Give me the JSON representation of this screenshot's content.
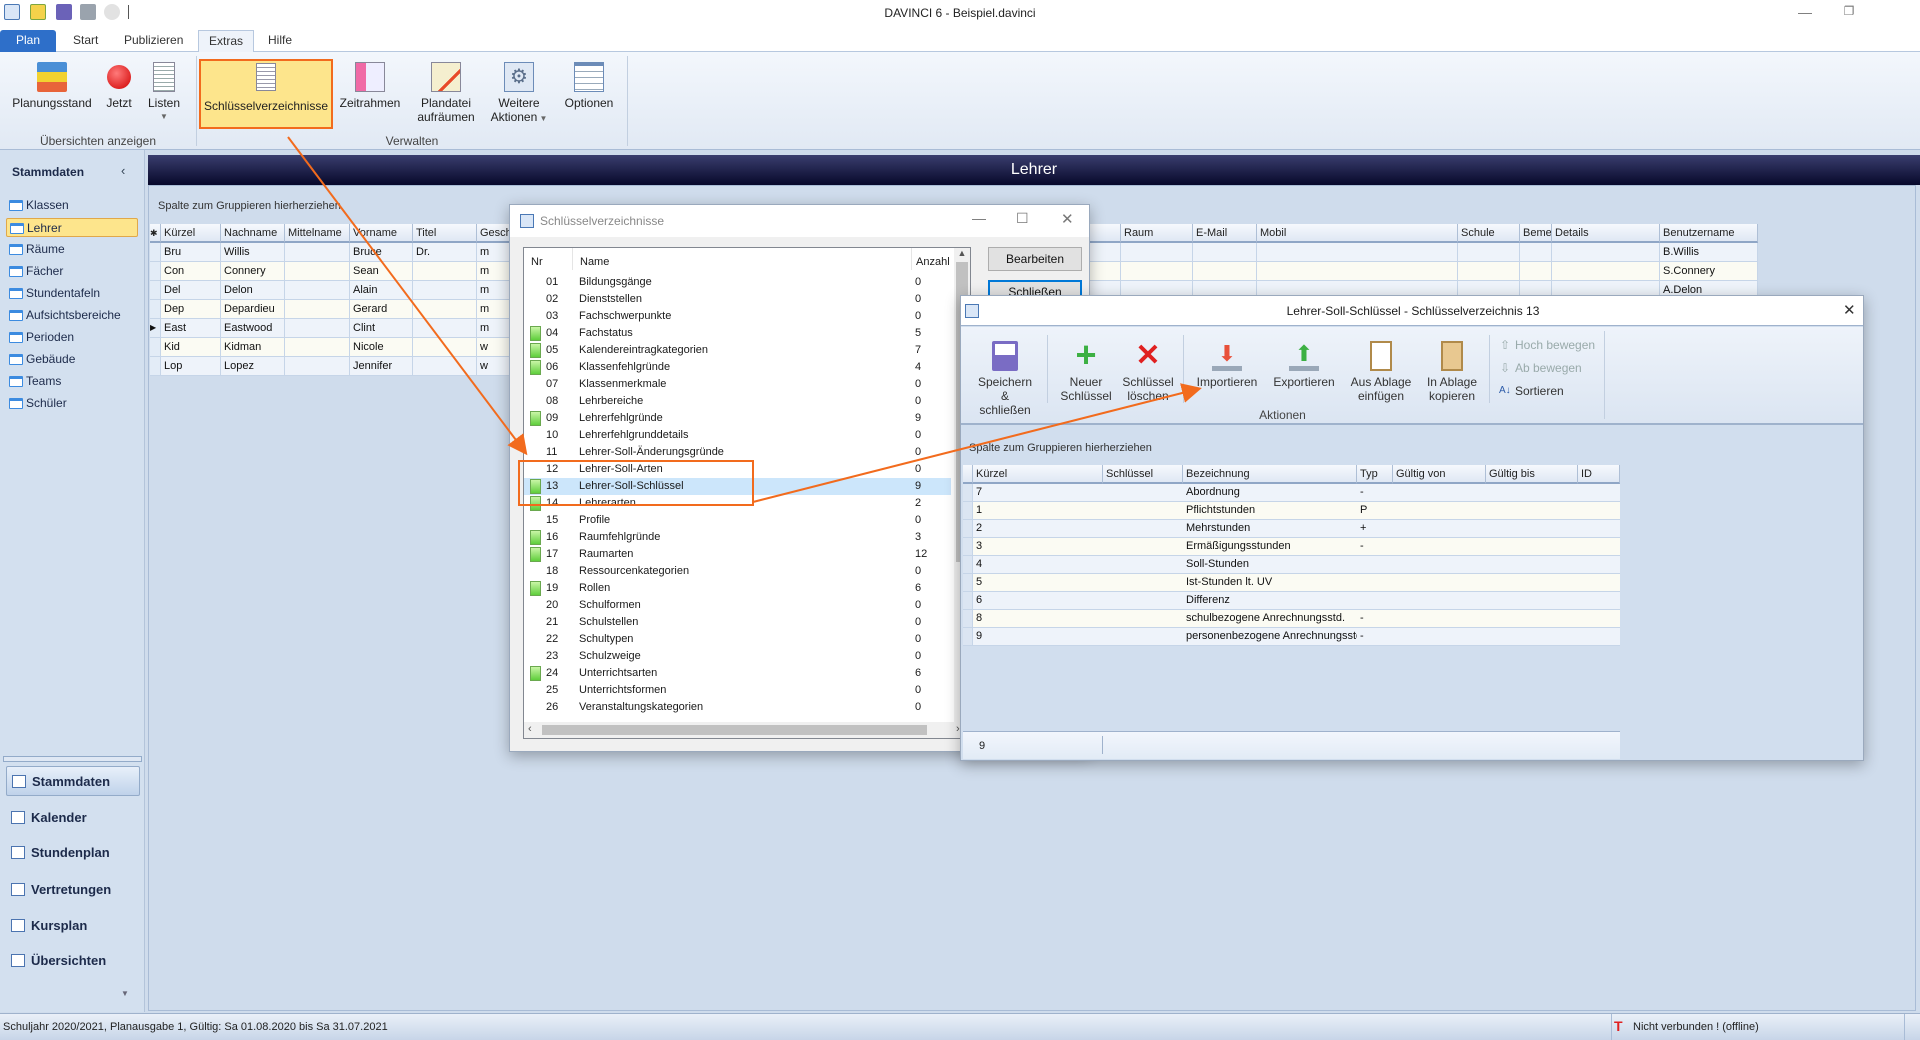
{
  "window": {
    "title": "DAVINCI 6 - Beispiel.davinci",
    "quick_access": [
      "app-icon",
      "open-icon",
      "save-icon",
      "print-icon",
      "refresh-icon"
    ]
  },
  "tabs": [
    {
      "label": "Plan"
    },
    {
      "label": "Start"
    },
    {
      "label": "Publizieren"
    },
    {
      "label": "Extras",
      "selected": true
    },
    {
      "label": "Hilfe"
    }
  ],
  "ribbon": {
    "groups": [
      {
        "label": "Übersichten anzeigen"
      },
      {
        "label": "Verwalten"
      }
    ],
    "buttons": [
      {
        "label": "Planungsstand",
        "icon": "layers-icon"
      },
      {
        "label": "Jetzt",
        "icon": "record-icon"
      },
      {
        "label": "Listen",
        "icon": "list-icon"
      },
      {
        "label": "Schlüsselverzeichnisse",
        "icon": "document-icon",
        "highlighted": true
      },
      {
        "label": "Zeitrahmen",
        "icon": "timeframe-icon"
      },
      {
        "label": "Plandatei",
        "label2": "aufräumen",
        "icon": "cleanup-icon"
      },
      {
        "label": "Weitere",
        "label2": "Aktionen",
        "icon": "gear-icon"
      },
      {
        "label": "Optionen",
        "icon": "options-icon"
      }
    ]
  },
  "sidebar": {
    "title": "Stammdaten",
    "items": [
      {
        "label": "Klassen"
      },
      {
        "label": "Lehrer",
        "selected": true
      },
      {
        "label": "Räume"
      },
      {
        "label": "Fächer"
      },
      {
        "label": "Stundentafeln"
      },
      {
        "label": "Aufsichtsbereiche"
      },
      {
        "label": "Perioden"
      },
      {
        "label": "Gebäude"
      },
      {
        "label": "Teams"
      },
      {
        "label": "Schüler"
      }
    ],
    "nav": [
      {
        "label": "Stammdaten",
        "icon": "folder-icon",
        "selected": true
      },
      {
        "label": "Kalender",
        "icon": "calendar-icon"
      },
      {
        "label": "Stundenplan",
        "icon": "timetable-icon"
      },
      {
        "label": "Vertretungen",
        "icon": "substitution-icon"
      },
      {
        "label": "Kursplan",
        "icon": "people-icon"
      },
      {
        "label": "Übersichten",
        "icon": "overview-icon"
      }
    ]
  },
  "main": {
    "title": "Lehrer",
    "group_hint": "Spalte zum Gruppieren hierherziehen",
    "columns": [
      "Kürzel",
      "Nachname",
      "Mittelname",
      "Vorname",
      "Titel",
      "Gesch",
      "Raum",
      "E-Mail",
      "Mobil",
      "Schule",
      "Beme",
      "Details",
      "Benutzername"
    ],
    "rows": [
      [
        "Bru",
        "Willis",
        "",
        "Bruce",
        "Dr.",
        "m",
        "",
        "",
        "",
        "",
        "",
        "",
        "B.Willis"
      ],
      [
        "Con",
        "Connery",
        "",
        "Sean",
        "",
        "m",
        "",
        "",
        "",
        "",
        "",
        "",
        "S.Connery"
      ],
      [
        "Del",
        "Delon",
        "",
        "Alain",
        "",
        "m",
        "",
        "",
        "",
        "",
        "",
        "",
        "A.Delon"
      ],
      [
        "Dep",
        "Depardieu",
        "",
        "Gerard",
        "",
        "m",
        "",
        "",
        "",
        "",
        "",
        "",
        ""
      ],
      [
        "East",
        "Eastwood",
        "",
        "Clint",
        "",
        "m",
        "",
        "",
        "",
        "",
        "",
        "",
        ""
      ],
      [
        "Kid",
        "Kidman",
        "",
        "Nicole",
        "",
        "w",
        "",
        "",
        "",
        "",
        "",
        "",
        ""
      ],
      [
        "Lop",
        "Lopez",
        "",
        "Jennifer",
        "",
        "w",
        "",
        "",
        "",
        "",
        "",
        "",
        ""
      ]
    ],
    "current_row": 4
  },
  "dialog_keys": {
    "title": "Schlüsselverzeichnisse",
    "headers": {
      "nr": "Nr",
      "name": "Name",
      "count": "Anzahl"
    },
    "items": [
      {
        "nr": "01",
        "name": "Bildungsgänge",
        "count": "0"
      },
      {
        "nr": "02",
        "name": "Dienststellen",
        "count": "0"
      },
      {
        "nr": "03",
        "name": "Fachschwerpunkte",
        "count": "0"
      },
      {
        "nr": "04",
        "name": "Fachstatus",
        "count": "5",
        "icon": true
      },
      {
        "nr": "05",
        "name": "Kalendereintragkategorien",
        "count": "7",
        "icon": true
      },
      {
        "nr": "06",
        "name": "Klassenfehlgründe",
        "count": "4",
        "icon": true
      },
      {
        "nr": "07",
        "name": "Klassenmerkmale",
        "count": "0"
      },
      {
        "nr": "08",
        "name": "Lehrbereiche",
        "count": "0"
      },
      {
        "nr": "09",
        "name": "Lehrerfehlgründe",
        "count": "9",
        "icon": true
      },
      {
        "nr": "10",
        "name": "Lehrerfehlgrunddetails",
        "count": "0"
      },
      {
        "nr": "11",
        "name": "Lehrer-Soll-Änderungsgründe",
        "count": "0"
      },
      {
        "nr": "12",
        "name": "Lehrer-Soll-Arten",
        "count": "0"
      },
      {
        "nr": "13",
        "name": "Lehrer-Soll-Schlüssel",
        "count": "9",
        "icon": true,
        "selected": true
      },
      {
        "nr": "14",
        "name": "Lehrerarten",
        "count": "2",
        "icon": true
      },
      {
        "nr": "15",
        "name": "Profile",
        "count": "0"
      },
      {
        "nr": "16",
        "name": "Raumfehlgründe",
        "count": "3",
        "icon": true
      },
      {
        "nr": "17",
        "name": "Raumarten",
        "count": "12",
        "icon": true
      },
      {
        "nr": "18",
        "name": "Ressourcenkategorien",
        "count": "0"
      },
      {
        "nr": "19",
        "name": "Rollen",
        "count": "6",
        "icon": true
      },
      {
        "nr": "20",
        "name": "Schulformen",
        "count": "0"
      },
      {
        "nr": "21",
        "name": "Schulstellen",
        "count": "0"
      },
      {
        "nr": "22",
        "name": "Schultypen",
        "count": "0"
      },
      {
        "nr": "23",
        "name": "Schulzweige",
        "count": "0"
      },
      {
        "nr": "24",
        "name": "Unterrichtsarten",
        "count": "6",
        "icon": true
      },
      {
        "nr": "25",
        "name": "Unterrichtsformen",
        "count": "0"
      },
      {
        "nr": "26",
        "name": "Veranstaltungskategorien",
        "count": "0"
      }
    ],
    "buttons": {
      "edit": "Bearbeiten",
      "close": "Schließen"
    }
  },
  "dialog_entries": {
    "title": "Lehrer-Soll-Schlüssel - Schlüsselverzeichnis 13",
    "toolbar": {
      "save": [
        "Speichern",
        "& schließen"
      ],
      "new": [
        "Neuer",
        "Schlüssel"
      ],
      "delete": [
        "Schlüssel",
        "löschen"
      ],
      "import": [
        "Importieren"
      ],
      "export": [
        "Exportieren"
      ],
      "paste": [
        "Aus Ablage",
        "einfügen"
      ],
      "copy": [
        "In Ablage",
        "kopieren"
      ],
      "move_up": "Hoch bewegen",
      "move_down": "Ab bewegen",
      "sort": "Sortieren",
      "group_label": "Aktionen"
    },
    "group_hint": "Spalte zum Gruppieren hierherziehen",
    "columns": [
      "Kürzel",
      "Schlüssel",
      "Bezeichnung",
      "Typ",
      "Gültig von",
      "Gültig bis",
      "ID"
    ],
    "rows": [
      [
        "7",
        "",
        "Abordnung",
        "-",
        "",
        "",
        ""
      ],
      [
        "1",
        "",
        "Pflichtstunden",
        "P",
        "",
        "",
        ""
      ],
      [
        "2",
        "",
        "Mehrstunden",
        "+",
        "",
        "",
        ""
      ],
      [
        "3",
        "",
        "Ermäßigungsstunden",
        "-",
        "",
        "",
        ""
      ],
      [
        "4",
        "",
        "Soll-Stunden",
        "",
        "",
        "",
        ""
      ],
      [
        "5",
        "",
        "Ist-Stunden lt. UV",
        "",
        "",
        "",
        ""
      ],
      [
        "6",
        "",
        "Differenz",
        "",
        "",
        "",
        ""
      ],
      [
        "8",
        "",
        "schulbezogene Anrechnungsstd.",
        "-",
        "",
        "",
        ""
      ],
      [
        "9",
        "",
        "personenbezogene Anrechnungsstd",
        "-",
        "",
        "",
        ""
      ]
    ],
    "footer_count": "9"
  },
  "statusbar": {
    "left": "Schuljahr 2020/2021, Planausgabe 1, Gültig: Sa 01.08.2020 bis Sa 31.07.2021",
    "right": "Nicht verbunden ! (offline)"
  },
  "colors": {
    "accent": "#2e6fc9",
    "highlight": "#fde58c",
    "annotation": "#f26b1d",
    "header": "#07082a"
  }
}
